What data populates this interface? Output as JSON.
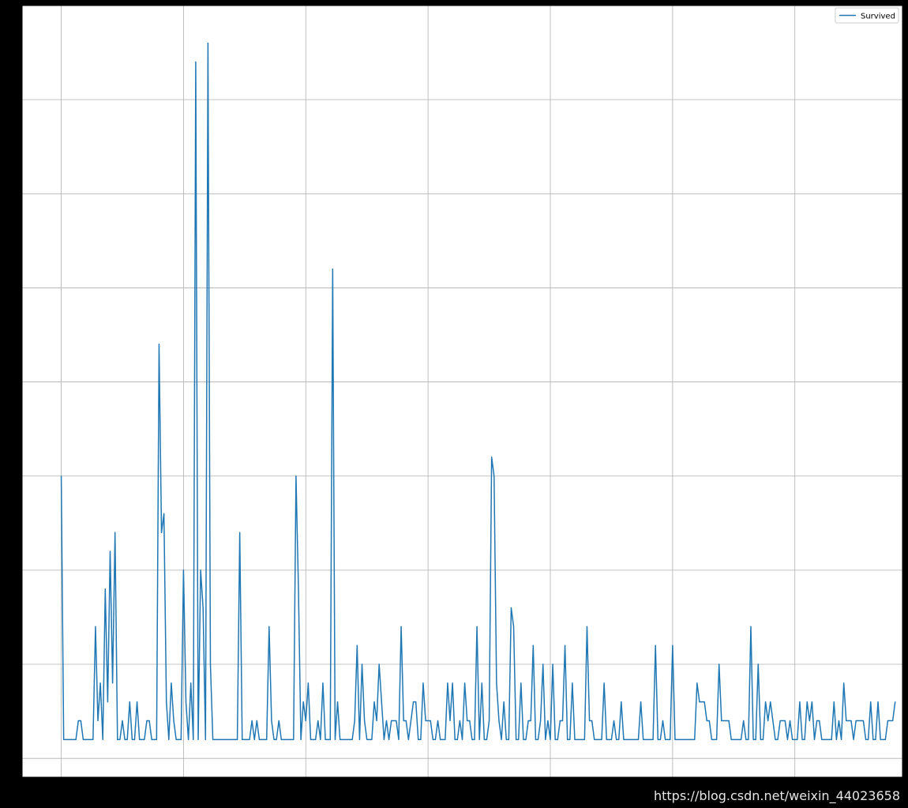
{
  "colors": {
    "page_background": "#000000",
    "plot_background": "#ffffff",
    "grid": "#b0b0b0",
    "series_line": "#1f77b4"
  },
  "watermark": "https://blog.csdn.net/weixin_44023658",
  "chart_data": {
    "type": "line",
    "title": "",
    "xlabel": "",
    "ylabel": "",
    "grid": true,
    "legend_position": "top-right",
    "x_start": 0,
    "xlim": [
      -8,
      172
    ],
    "ylim": [
      -1,
      40
    ],
    "x_grid": [
      0,
      25,
      50,
      75,
      100,
      125,
      150
    ],
    "y_grid": [
      0,
      5,
      10,
      15,
      20,
      25,
      30,
      35
    ],
    "series": [
      {
        "name": "Survived",
        "color": "#1f77b4",
        "values": [
          15,
          1,
          1,
          1,
          1,
          1,
          1,
          2,
          2,
          1,
          1,
          1,
          1,
          1,
          7,
          2,
          4,
          1,
          9,
          3,
          11,
          4,
          12,
          1,
          1,
          2,
          1,
          1,
          3,
          1,
          1,
          3,
          1,
          1,
          1,
          2,
          2,
          1,
          1,
          1,
          22,
          12,
          13,
          3,
          1,
          4,
          2,
          1,
          1,
          1,
          10,
          3,
          1,
          4,
          1,
          37,
          1,
          10,
          8,
          1,
          38,
          5,
          1,
          1,
          1,
          1,
          1,
          1,
          1,
          1,
          1,
          1,
          1,
          12,
          1,
          1,
          1,
          1,
          2,
          1,
          2,
          1,
          1,
          1,
          1,
          7,
          2,
          1,
          1,
          2,
          1,
          1,
          1,
          1,
          1,
          1,
          15,
          9,
          1,
          3,
          2,
          4,
          1,
          1,
          1,
          2,
          1,
          4,
          1,
          1,
          1,
          26,
          1,
          3,
          1,
          1,
          1,
          1,
          1,
          1,
          2,
          6,
          1,
          5,
          2,
          1,
          1,
          1,
          3,
          2,
          5,
          3,
          1,
          2,
          1,
          2,
          2,
          2,
          1,
          7,
          2,
          2,
          1,
          2,
          3,
          3,
          1,
          1,
          4,
          2,
          2,
          2,
          1,
          1,
          2,
          1,
          1,
          1,
          4,
          2,
          4,
          1,
          1,
          2,
          1,
          4,
          2,
          2,
          1,
          1,
          7,
          1,
          4,
          1,
          1,
          2,
          16,
          15,
          4,
          2,
          1,
          3,
          1,
          1,
          8,
          7,
          1,
          1,
          4,
          1,
          1,
          2,
          2,
          6,
          1,
          1,
          2,
          5,
          1,
          2,
          1,
          5,
          1,
          1,
          2,
          2,
          6,
          1,
          1,
          4,
          1,
          1,
          1,
          1,
          1,
          7,
          2,
          2,
          1,
          1,
          1,
          1,
          4,
          1,
          1,
          1,
          2,
          1,
          1,
          3,
          1,
          1,
          1,
          1,
          1,
          1,
          1,
          3,
          1,
          1,
          1,
          1,
          1,
          6,
          1,
          1,
          2,
          1,
          1,
          1,
          6,
          1,
          1,
          1,
          1,
          1,
          1,
          1,
          1,
          1,
          4,
          3,
          3,
          3,
          2,
          2,
          1,
          1,
          1,
          5,
          2,
          2,
          2,
          2,
          1,
          1,
          1,
          1,
          1,
          2,
          1,
          1,
          7,
          1,
          1,
          5,
          1,
          1,
          3,
          2,
          3,
          2,
          1,
          1,
          2,
          2,
          2,
          1,
          2,
          1,
          1,
          1,
          3,
          1,
          1,
          3,
          2,
          3,
          1,
          2,
          2,
          1,
          1,
          1,
          1,
          1,
          3,
          1,
          2,
          1,
          4,
          2,
          2,
          2,
          1,
          2,
          2,
          2,
          2,
          1,
          1,
          3,
          1,
          1,
          3,
          1,
          1,
          1,
          2,
          2,
          2,
          3
        ]
      }
    ]
  }
}
